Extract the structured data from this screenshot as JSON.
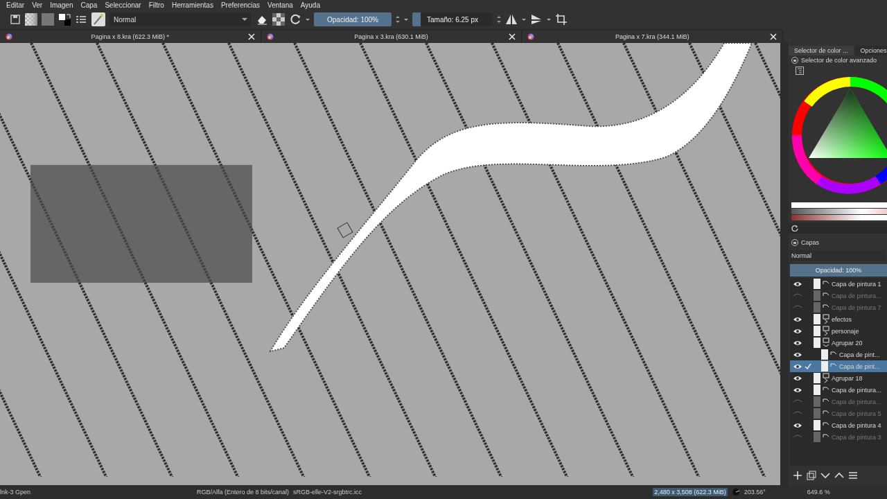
{
  "menu": [
    "Editar",
    "Ver",
    "Imagen",
    "Capa",
    "Seleccionar",
    "Filtro",
    "Herramientas",
    "Preferencias",
    "Ventana",
    "Ayuda"
  ],
  "toolbar": {
    "blend_mode": "Normal",
    "opacity": {
      "label": "Opacidad: 100%",
      "level": 1
    },
    "size": {
      "label": "Tamaño: 6.25 px",
      "level": 0.1
    }
  },
  "tabs": [
    {
      "title": "Pagina x 8.kra (622.3 MiB) *"
    },
    {
      "title": "Pagina x 3.kra (630.1 MiB)"
    },
    {
      "title": "Pagina x 7.kra (344.1 MiB)"
    }
  ],
  "dock": {
    "tabs": [
      {
        "label": "Selector de color ...",
        "selected": true
      },
      {
        "label": "Opciones",
        "selected": false
      }
    ],
    "color_selector": {
      "title": "Selector de color avanzado"
    },
    "layers": {
      "title": "Capas",
      "blend_mode": "Normal",
      "opacity": {
        "label": "Opacidad:  100%",
        "level": 1
      },
      "items": [
        {
          "name": "Capa de pintura 1",
          "kind": "paint",
          "visible": true,
          "selected": false
        },
        {
          "name": "Capa de pintura...",
          "kind": "paint",
          "visible": false,
          "selected": false
        },
        {
          "name": "Capa de pintura 7",
          "kind": "paint",
          "visible": false,
          "selected": false
        },
        {
          "name": "efectos",
          "kind": "group",
          "visible": true,
          "selected": false,
          "expanded": false
        },
        {
          "name": "personaje",
          "kind": "group",
          "visible": true,
          "selected": false,
          "expanded": false
        },
        {
          "name": "Agrupar 20",
          "kind": "group",
          "visible": true,
          "selected": false,
          "expanded": true,
          "children": [
            {
              "name": "Capa de pint...",
              "kind": "paint",
              "visible": true,
              "selected": false
            },
            {
              "name": "Capa de pint...",
              "kind": "paint",
              "visible": true,
              "selected": true
            }
          ]
        },
        {
          "name": "Agrupar 18",
          "kind": "group",
          "visible": true,
          "selected": false,
          "expanded": false
        },
        {
          "name": "Capa de pintura...",
          "kind": "paint",
          "visible": true,
          "selected": false
        },
        {
          "name": "Capa de pintura...",
          "kind": "paint",
          "visible": false,
          "selected": false
        },
        {
          "name": "Capa de pintura 5",
          "kind": "paint",
          "visible": false,
          "selected": false
        },
        {
          "name": "Capa de pintura 4",
          "kind": "paint",
          "visible": true,
          "selected": false
        },
        {
          "name": "Capa de pintura 3",
          "kind": "paint",
          "visible": false,
          "selected": false
        }
      ]
    }
  },
  "status_bar": {
    "brush": "lnk-3 Gpen",
    "color_space": "RGB/Alfa (Entero de 8 bits/canal)",
    "profile": "sRGB-elle-V2-srgbtrc.icc",
    "size": "2,480 x 3,508 (622.3 MiB)",
    "angle": "203.56°",
    "zoom": "649.6 %"
  }
}
